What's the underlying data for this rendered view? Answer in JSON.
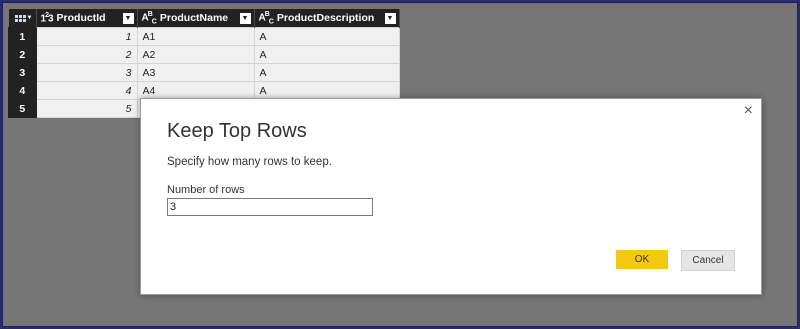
{
  "grid": {
    "columns": [
      {
        "type_icon": "123",
        "name": "ProductId"
      },
      {
        "type_icon": "ABC",
        "name": "ProductName"
      },
      {
        "type_icon": "ABC",
        "name": "ProductDescription"
      }
    ],
    "rows": [
      {
        "num": "1",
        "id": "1",
        "name": "A1",
        "desc": "A"
      },
      {
        "num": "2",
        "id": "2",
        "name": "A2",
        "desc": "A"
      },
      {
        "num": "3",
        "id": "3",
        "name": "A3",
        "desc": "A"
      },
      {
        "num": "4",
        "id": "4",
        "name": "A4",
        "desc": "A"
      },
      {
        "num": "5",
        "id": "5",
        "name": "",
        "desc": ""
      }
    ]
  },
  "dialog": {
    "title": "Keep Top Rows",
    "subtitle": "Specify how many rows to keep.",
    "field_label": "Number of rows",
    "field_value": "3",
    "ok_label": "OK",
    "cancel_label": "Cancel",
    "close_glyph": "×"
  },
  "colors": {
    "ok_button": "#f2c811",
    "header_bg": "#222222",
    "backdrop": "#767676"
  },
  "icons": [
    "table-icon",
    "type-number-icon",
    "type-text-icon",
    "dropdown-icon",
    "close-icon"
  ]
}
